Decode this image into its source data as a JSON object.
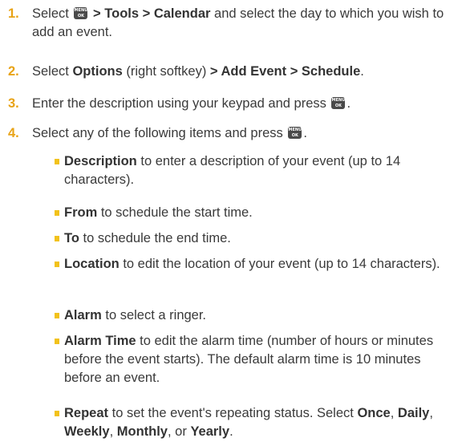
{
  "steps": [
    {
      "num": "1.",
      "parts": [
        {
          "t": "Select "
        },
        {
          "icon": "menu-ok-key"
        },
        {
          "t": " > Tools > Calendar",
          "b": true
        },
        {
          "t": " and select the day to which you wish to add an event."
        }
      ]
    },
    {
      "num": "2.",
      "parts": [
        {
          "t": "Select "
        },
        {
          "t": "Options",
          "b": true
        },
        {
          "t": " (right softkey) "
        },
        {
          "t": "> Add Event > Schedule",
          "b": true
        },
        {
          "t": "."
        }
      ]
    },
    {
      "num": "3.",
      "parts": [
        {
          "t": "Enter the description using your keypad and press "
        },
        {
          "icon": "menu-ok-key"
        },
        {
          "t": "."
        }
      ]
    },
    {
      "num": "4.",
      "parts": [
        {
          "t": "Select any of the following items and press "
        },
        {
          "icon": "menu-ok-key"
        },
        {
          "t": "."
        }
      ],
      "subitems": [
        [
          {
            "t": "Description",
            "b": true
          },
          {
            "t": " to enter a description of your event (up to 14 characters)."
          }
        ],
        [
          {
            "t": "From",
            "b": true
          },
          {
            "t": " to schedule the start time."
          }
        ],
        [
          {
            "t": "To",
            "b": true
          },
          {
            "t": " to schedule the end time."
          }
        ],
        [
          {
            "t": "Location",
            "b": true
          },
          {
            "t": " to edit the location of your event (up to 14 characters)."
          }
        ],
        [
          {
            "t": "Alarm",
            "b": true
          },
          {
            "t": " to select a ringer."
          }
        ],
        [
          {
            "t": "Alarm Time",
            "b": true
          },
          {
            "t": " to edit the alarm time (number of hours or minutes before the event starts). The default alarm time is 10 minutes before an event."
          }
        ],
        [
          {
            "t": "Repeat",
            "b": true
          },
          {
            "t": " to set the event's repeating status. Select "
          },
          {
            "t": "Once",
            "b": true
          },
          {
            "t": ", "
          },
          {
            "t": "Daily",
            "b": true
          },
          {
            "t": ", "
          },
          {
            "t": "Weekly",
            "b": true
          },
          {
            "t": ", "
          },
          {
            "t": "Monthly",
            "b": true
          },
          {
            "t": ", or "
          },
          {
            "t": "Yearly",
            "b": true
          },
          {
            "t": "."
          }
        ]
      ]
    }
  ],
  "icon_text": {
    "top": "MENU",
    "bottom": "OK"
  },
  "colors": {
    "step_number": "#e8a317",
    "bullet": "#f2c21b",
    "text": "#3a3a3a",
    "key_bg": "#4a4a4a"
  }
}
